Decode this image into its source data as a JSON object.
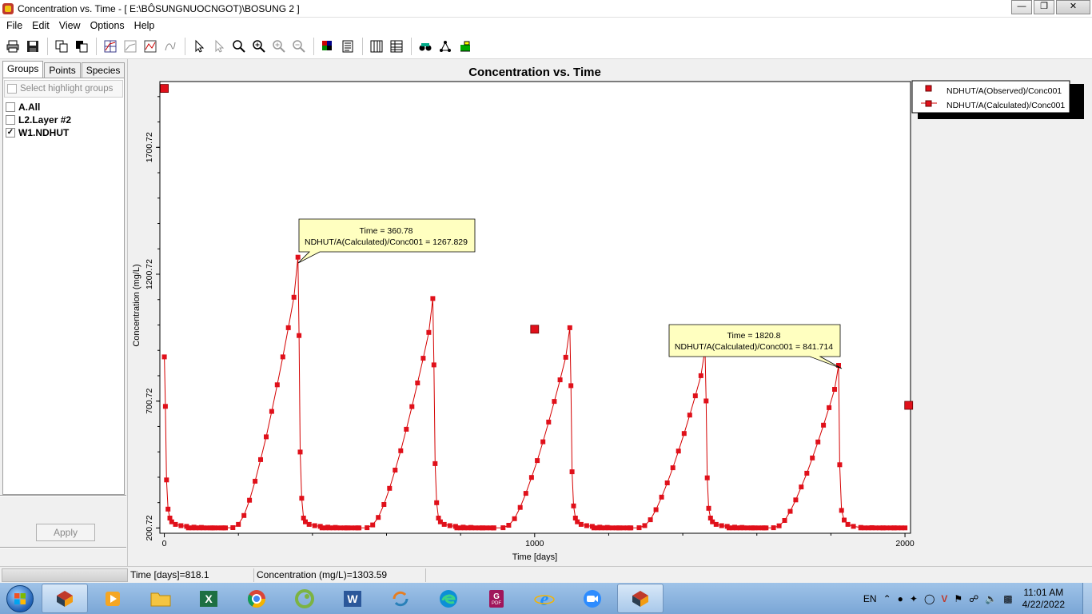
{
  "window": {
    "title": "Concentration vs. Time - [ E:\\BÔSUNGNUOCNGOT)\\BOSUNG 2 ]",
    "minimize": "",
    "maximize": "",
    "close": ""
  },
  "menu": [
    "File",
    "Edit",
    "View",
    "Options",
    "Help"
  ],
  "left_panel": {
    "tabs": [
      "Groups",
      "Points",
      "Species"
    ],
    "active_tab": "Groups",
    "highlight_placeholder": "Select highlight groups",
    "groups": [
      {
        "label": "A.All",
        "checked": false
      },
      {
        "label": "L2.Layer #2",
        "checked": false
      },
      {
        "label": "W1.NDHUT",
        "checked": true
      }
    ],
    "apply_label": "Apply"
  },
  "status": {
    "time": "Time  [days]=818.1",
    "concentration": "Concentration (mg/L)=1303.59"
  },
  "taskbar": {
    "lang": "EN",
    "time": "11:01 AM",
    "date": "4/22/2022"
  },
  "colors": {
    "series": "#d40000",
    "marker": "#e0101a",
    "tooltip_bg": "#ffffc0"
  },
  "chart_data": {
    "type": "line",
    "title": "Concentration vs. Time",
    "xlabel": "Time  [days]",
    "ylabel": "Concentration (mg/L)",
    "xlim": [
      -12,
      2015
    ],
    "ylim": [
      180,
      1960
    ],
    "x_ticks": [
      0,
      1000,
      2000
    ],
    "y_ticks": [
      200.72,
      700.72,
      1200.72,
      1700.72
    ],
    "y_tick_labels": [
      "200.72",
      "700.72",
      "1200.72",
      "1700.72"
    ],
    "x_tick_labels": [
      "0",
      "1000",
      "2000"
    ],
    "legend": {
      "position": "top-right",
      "entries": [
        "NDHUT/A(Observed)/Conc001",
        "NDHUT/A(Calculated)/Conc001"
      ]
    },
    "series": [
      {
        "name": "NDHUT/A(Observed)/Conc001",
        "kind": "scatter",
        "x": [
          0,
          1000,
          2010
        ],
        "y": [
          1933,
          984,
          684
        ]
      },
      {
        "name": "NDHUT/A(Calculated)/Conc001",
        "kind": "line",
        "cycle": {
          "x": [
            0,
            3,
            6,
            10,
            15,
            20,
            30,
            45,
            60,
            80,
            100,
            130,
            160,
            185,
            200,
            215,
            230,
            245,
            260,
            275,
            290,
            305,
            320,
            335,
            350,
            360.78
          ],
          "y": [
            875,
            680,
            390,
            275,
            240,
            225,
            215,
            210,
            207,
            204,
            203,
            201,
            201,
            202,
            215,
            250,
            310,
            385,
            470,
            560,
            660,
            765,
            875,
            990,
            1110,
            1267.829
          ]
        },
        "peaks": [
          {
            "x": 360.78,
            "y": 1267.829
          },
          {
            "x": 725,
            "y": 1105
          },
          {
            "x": 1095,
            "y": 990
          },
          {
            "x": 1460,
            "y": 905
          },
          {
            "x": 1820.8,
            "y": 841.714
          }
        ],
        "x_end": 2000
      }
    ],
    "annotations": [
      {
        "lines": [
          "Time = 360.78",
          "NDHUT/A(Calculated)/Conc001 = 1267.829"
        ]
      },
      {
        "lines": [
          "Time = 1820.8",
          "NDHUT/A(Calculated)/Conc001 = 841.714"
        ]
      }
    ]
  }
}
